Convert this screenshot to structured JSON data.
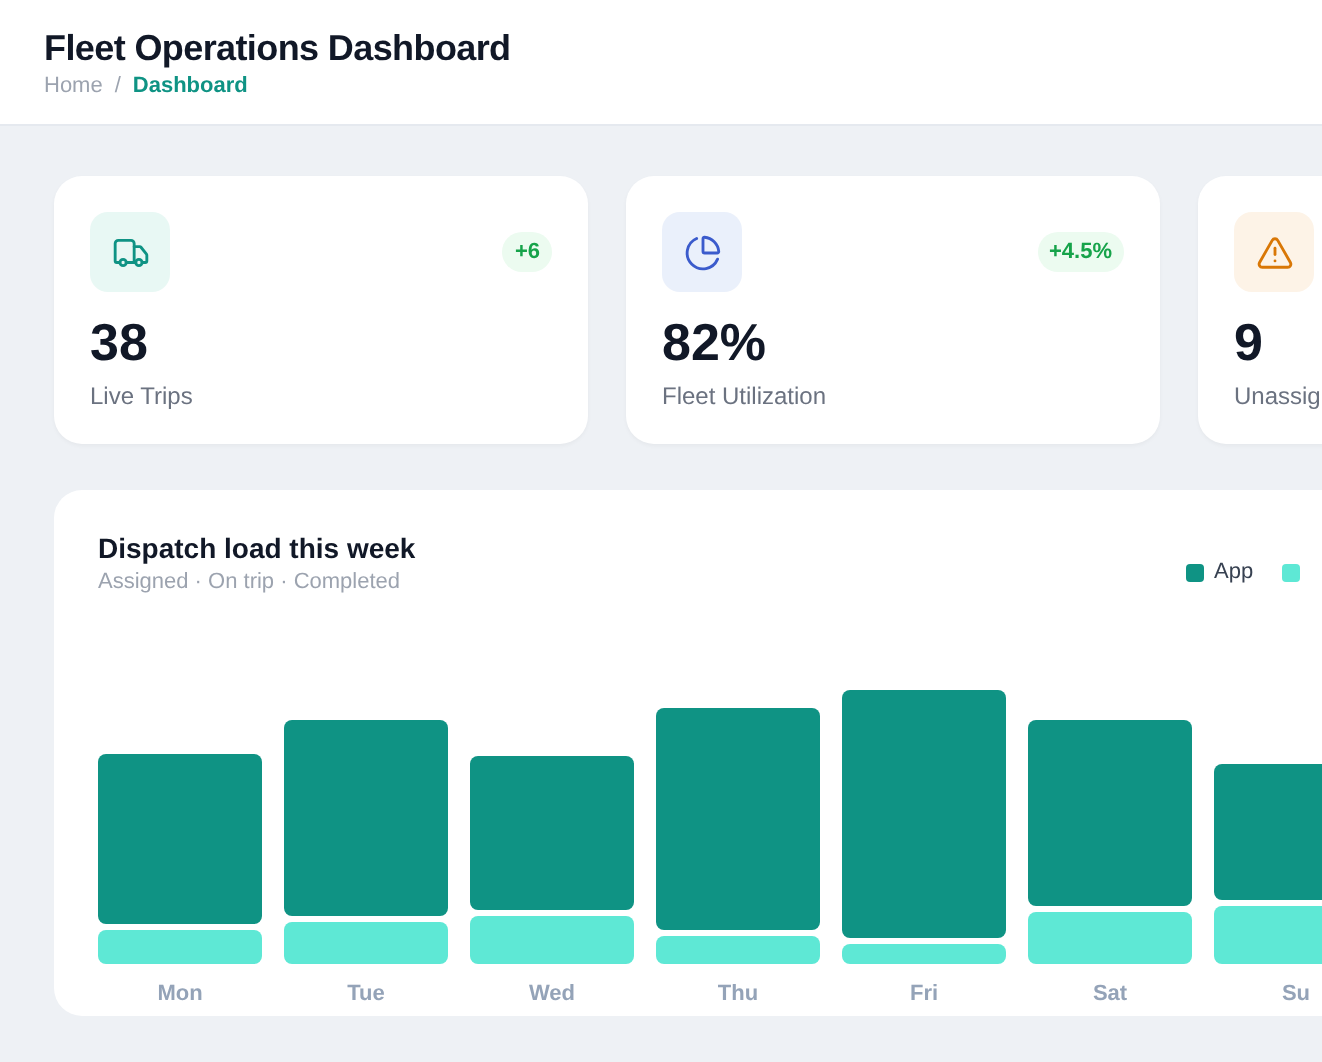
{
  "header": {
    "title": "Fleet Operations Dashboard",
    "separator": "/",
    "breadcrumb": [
      {
        "label": "Home",
        "selected": false
      },
      {
        "label": "Dashboard",
        "selected": true
      }
    ]
  },
  "stats": [
    {
      "value": "38",
      "label": "Live Trips",
      "badge": "+6"
    },
    {
      "value": "82%",
      "label": "Fleet Utilization",
      "badge": "+4.5%"
    },
    {
      "value": "9",
      "label": "Unassig"
    }
  ],
  "chart_card": {
    "title": "Dispatch load this week",
    "subtitle": "Assigned · On trip · Completed",
    "legend": [
      {
        "label": "App",
        "color": "#0f9384"
      },
      {
        "color": "#5ee8d5"
      }
    ],
    "days": [
      "Mon",
      "Tue",
      "Wed",
      "Thu",
      "Fri",
      "Sat",
      "Su"
    ]
  }
}
